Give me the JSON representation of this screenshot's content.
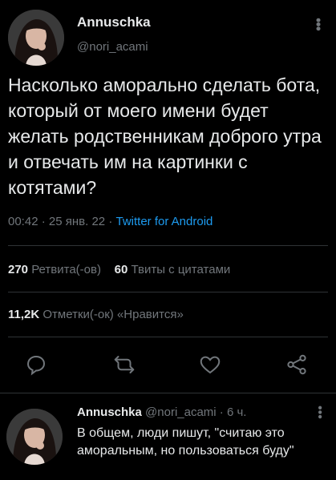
{
  "tweet": {
    "author_name": "Annuschka",
    "author_handle": "@nori_acami",
    "text": "Насколько аморально сделать бота, который от моего имени будет желать родственникам доброго утра и отвечать им на картинки с котятами?",
    "time": "00:42",
    "date": "25 янв. 22",
    "client": "Twitter for Android",
    "retweets_count": "270",
    "retweets_label": "Ретвита(-ов)",
    "quotes_count": "60",
    "quotes_label": "Твиты с цитатами",
    "likes_count": "11,2K",
    "likes_label": "Отметки(-ок) «Нравится»"
  },
  "actions": [
    "reply-icon",
    "retweet-icon",
    "like-icon",
    "share-icon"
  ],
  "reply": {
    "author_name": "Annuschka",
    "author_handle": "@nori_acami",
    "time_ago": "6 ч.",
    "text": "В общем, люди пишут, \"считаю это аморальным, но пользоваться буду\""
  },
  "colors": {
    "background": "#000000",
    "text": "#e7e9ea",
    "muted": "#71767b",
    "link": "#1d9bf0",
    "divider": "#2f3336"
  }
}
